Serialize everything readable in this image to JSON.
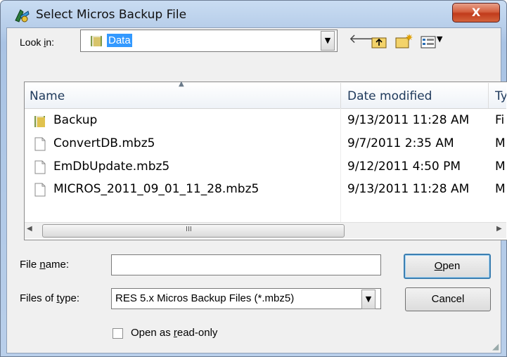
{
  "window": {
    "title": "Select Micros Backup File",
    "close_label": "X"
  },
  "lookin": {
    "label_pre": "Look ",
    "label_ul": "i",
    "label_post": "n:",
    "value": "Data"
  },
  "columns": {
    "name": "Name",
    "date": "Date modified",
    "type": "Ty"
  },
  "files": [
    {
      "name": "Backup",
      "date": "9/13/2011 11:28 AM",
      "type": "Fi",
      "icon": "folder-icon"
    },
    {
      "name": "ConvertDB.mbz5",
      "date": "9/7/2011 2:35 AM",
      "type": "M",
      "icon": "file-icon"
    },
    {
      "name": "EmDbUpdate.mbz5",
      "date": "9/12/2011 4:50 PM",
      "type": "M",
      "icon": "file-icon"
    },
    {
      "name": "MICROS_2011_09_01_11_28.mbz5",
      "date": "9/13/2011 11:28 AM",
      "type": "M",
      "icon": "file-icon"
    }
  ],
  "filename": {
    "label_pre": "File ",
    "label_ul": "n",
    "label_post": "ame:",
    "value": ""
  },
  "filetype": {
    "label_pre": "Files of ",
    "label_ul": "t",
    "label_post": "ype:",
    "value": "RES 5.x Micros Backup Files (*.mbz5)"
  },
  "buttons": {
    "open_ul": "O",
    "open_post": "pen",
    "cancel": "Cancel"
  },
  "readonly": {
    "label_pre": "Open as ",
    "label_ul": "r",
    "label_post": "ead-only",
    "checked": false
  },
  "scroll_grip": "III"
}
